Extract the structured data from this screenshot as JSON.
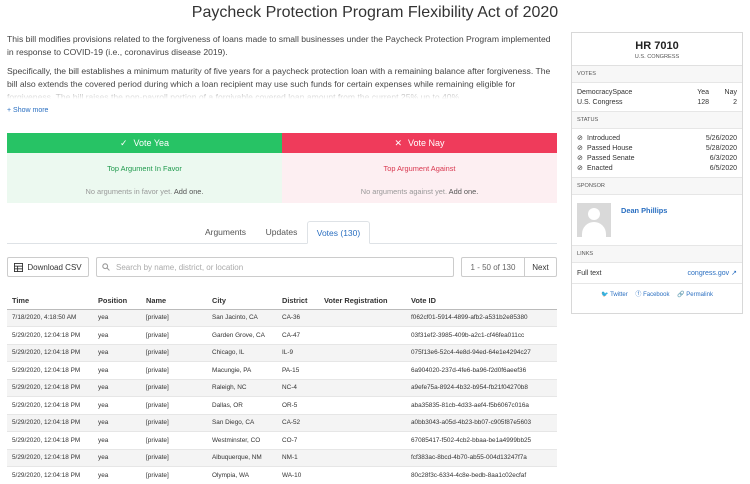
{
  "title": "Paycheck Protection Program Flexibility Act of 2020",
  "description": {
    "p1": "This bill modifies provisions related to the forgiveness of loans made to small businesses under the Paycheck Protection Program implemented in response to COVID-19 (i.e., coronavirus disease 2019).",
    "p2": "Specifically, the bill establishes a minimum maturity of five years for a paycheck protection loan with a remaining balance after forgiveness. The bill also extends the covered period during which a loan recipient may use such funds for certain expenses while remaining eligible for forgiveness. The bill raises the non-payroll portion of a forgivable covered loan amount from the current 25% up to 40%.",
    "show_more": "Show more"
  },
  "vote_buttons": {
    "yea": "Vote Yea",
    "nay": "Vote Nay"
  },
  "arguments": {
    "favor_head": "Top Argument In Favor",
    "favor_empty": "No arguments in favor yet.",
    "against_head": "Top Argument Against",
    "against_empty": "No arguments against yet.",
    "add_one": "Add one."
  },
  "tabs": [
    "Arguments",
    "Updates",
    "Votes (130)"
  ],
  "toolbar": {
    "csv": "Download CSV",
    "search_placeholder": "Search by name, district, or location",
    "page_info": "1 - 50 of 130",
    "next": "Next"
  },
  "table": {
    "columns": [
      "Time",
      "Position",
      "Name",
      "City",
      "District",
      "Voter Registration",
      "Vote ID"
    ],
    "rows": [
      [
        "7/18/2020, 4:18:50 AM",
        "yea",
        "[private]",
        "San Jacinto, CA",
        "CA-36",
        "",
        "f062cf01-5914-4899-afb2-a531b2e85380"
      ],
      [
        "5/29/2020, 12:04:18 PM",
        "yea",
        "[private]",
        "Garden Grove, CA",
        "CA-47",
        "",
        "03f31ef2-3985-409b-a2c1-cf46fea011cc"
      ],
      [
        "5/29/2020, 12:04:18 PM",
        "yea",
        "[private]",
        "Chicago, IL",
        "IL-9",
        "",
        "075f13e6-52c4-4e8d-94ed-64e1e4294c27"
      ],
      [
        "5/29/2020, 12:04:18 PM",
        "yea",
        "[private]",
        "Macungie, PA",
        "PA-15",
        "",
        "6a904020-237d-4fe6-ba96-f2d0f6aeef36"
      ],
      [
        "5/29/2020, 12:04:18 PM",
        "yea",
        "[private]",
        "Raleigh, NC",
        "NC-4",
        "",
        "a9efe75a-8924-4b32-b954-fb21f04270b8"
      ],
      [
        "5/29/2020, 12:04:18 PM",
        "yea",
        "[private]",
        "Dallas, OR",
        "OR-5",
        "",
        "aba35835-81cb-4d33-aef4-f5b6067c016a"
      ],
      [
        "5/29/2020, 12:04:18 PM",
        "yea",
        "[private]",
        "San Diego, CA",
        "CA-52",
        "",
        "a0bb3043-a05d-4b23-bb07-c905f87e5603"
      ],
      [
        "5/29/2020, 12:04:18 PM",
        "yea",
        "[private]",
        "Westminster, CO",
        "CO-7",
        "",
        "67085417-f502-4cb2-bbaa-be1a4999bb25"
      ],
      [
        "5/29/2020, 12:04:18 PM",
        "yea",
        "[private]",
        "Albuquerque, NM",
        "NM-1",
        "",
        "fcf383ac-8bcd-4b70-ab55-004d13247f7a"
      ],
      [
        "5/29/2020, 12:04:18 PM",
        "yea",
        "[private]",
        "Olympia, WA",
        "WA-10",
        "",
        "80c28f3c-6334-4c8e-bedb-8aa1c02ecfaf"
      ]
    ]
  },
  "sidebar": {
    "bill": "HR 7010",
    "congress": "U.S. CONGRESS",
    "votes_head": "VOTES",
    "votes_cols": {
      "yea": "Yea",
      "nay": "Nay"
    },
    "votes": [
      {
        "name": "DemocracySpace",
        "yea": "",
        "nay": ""
      },
      {
        "name": "U.S. Congress",
        "yea": "128",
        "nay": "2"
      }
    ],
    "status_head": "STATUS",
    "status": [
      {
        "name": "Introduced",
        "date": "5/26/2020"
      },
      {
        "name": "Passed House",
        "date": "5/28/2020"
      },
      {
        "name": "Passed Senate",
        "date": "6/3/2020"
      },
      {
        "name": "Enacted",
        "date": "6/5/2020"
      }
    ],
    "sponsor_head": "SPONSOR",
    "sponsor_name": "Dean Phillips",
    "links_head": "LINKS",
    "full_text_label": "Full text",
    "full_text_link": "congress.gov",
    "share": {
      "twitter": "Twitter",
      "facebook": "Facebook",
      "permalink": "Permalink"
    }
  },
  "colors": {
    "yea": "#27c365",
    "nay": "#ef3b5b",
    "link": "#2a6fc1"
  }
}
